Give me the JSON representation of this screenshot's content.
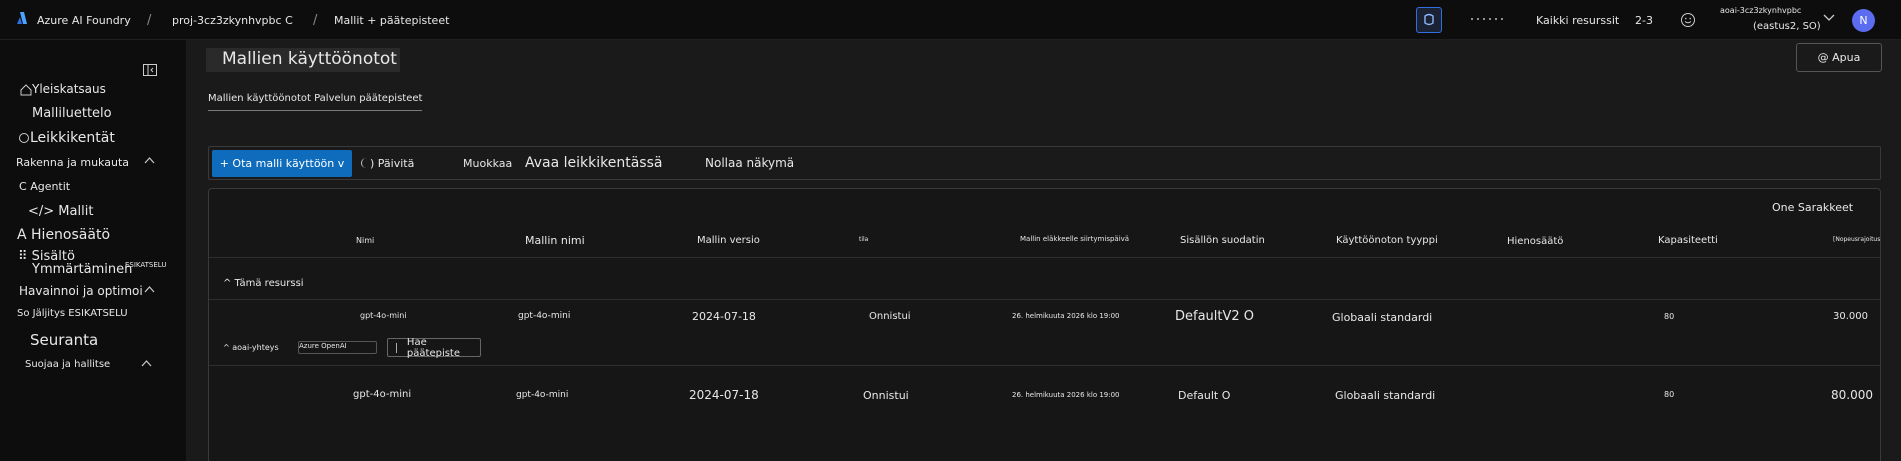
{
  "topbar": {
    "brand": "Azure AI Foundry",
    "project": "proj-3cz3zkynhvpbc",
    "project_suffix": "C",
    "page": "Mallit + päätepisteet",
    "all_resources": "Kaikki resurssit",
    "counter": "2-3",
    "account_line1": "aoai-3cz3zkynhvpbc",
    "account_line2": "(eastus2, SO)",
    "avatar_initial": "N"
  },
  "sidebar": {
    "items": [
      {
        "label": "Yleiskatsaus"
      },
      {
        "label": "Malliluettelo"
      },
      {
        "label": "Leikkikentät"
      },
      {
        "label": "Rakenna ja mukauta"
      },
      {
        "label": "Agentit"
      },
      {
        "label": "</> Mallit"
      },
      {
        "label": "A Hienosäätö"
      },
      {
        "label": "Sisältö"
      },
      {
        "label": "Ymmärtäminen"
      },
      {
        "label": "ESIKATSELU"
      },
      {
        "label": "Havainnoi ja optimoi"
      },
      {
        "label": "So Jäljitys ESIKATSELU"
      },
      {
        "label": "Seuranta"
      },
      {
        "label": "Suojaa ja hallitse"
      }
    ]
  },
  "main": {
    "title": "Mallien käyttöönotot",
    "help": "@ Apua",
    "tab": "Mallien käyttöönotot Palvelun päätepisteet",
    "toolbar": {
      "deploy": "+ Ota malli käyttöön v",
      "refresh": ") Päivitä",
      "edit": "Muokkaa",
      "open_playground": "Avaa leikkikentässä",
      "reset_view": "Nollaa näkymä"
    },
    "columns_button": "One Sarakkeet",
    "columns": {
      "name": "Nimi",
      "model_name": "Mallin nimi",
      "model_version": "Mallin versio",
      "state": "tila",
      "retirement": "Mallin eläkkeelle siirtymispäivä",
      "content_filter": "Sisällön suodatin",
      "deployment_type": "Käyttöönoton tyyppi",
      "fine_tuning": "Hienosäätö",
      "capacity": "Kapasiteetti",
      "rate_limit": "[Nopeusrajoitus"
    },
    "group_label": "^ Tämä resurssi",
    "rows": [
      {
        "name": "gpt-4o-mini",
        "model_name": "gpt-4o-mini",
        "version": "2024-07-18",
        "state": "Onnistui",
        "retirement": "26. helmikuuta 2026 klo 19:00",
        "filter": "DefaultV2 O",
        "type": "Globaali standardi",
        "capacity": "80",
        "rate": "30.000"
      },
      {
        "name": "gpt-4o-mini",
        "model_name": "gpt-4o-mini",
        "version": "2024-07-18",
        "state": "Onnistui",
        "retirement": "26. helmikuuta 2026 klo 19:00",
        "filter": "Default O",
        "type": "Globaali standardi",
        "capacity": "80",
        "rate": "80.000"
      }
    ],
    "connection": {
      "label": "^ aoai-yhteys",
      "value": "Azure OpenAI",
      "endpoint_button": "Hae päätepiste"
    }
  }
}
